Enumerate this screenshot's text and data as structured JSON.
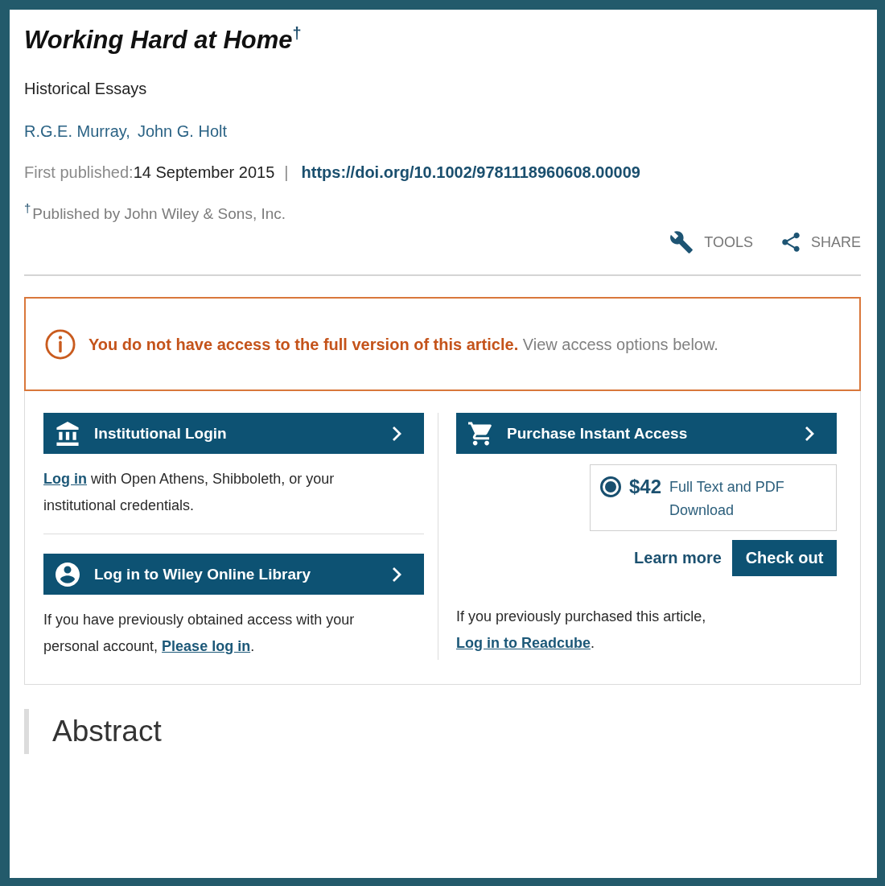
{
  "article": {
    "title": "Working Hard at Home$^{†}$",
    "subtitle": "Historical Essays",
    "authors": [
      "R.G.E. Murray,",
      "John G. Holt"
    ],
    "published_label": "First published:",
    "published_date": "14 September 2015",
    "separator": "|",
    "doi": "https://doi.org/10.1002/9781118960608.00009",
    "footnote": "$^{†}$Published by John Wiley & Sons, Inc."
  },
  "actions": [
    {
      "kind": "tools",
      "label": "TOOLS"
    },
    {
      "kind": "share",
      "label": "SHARE"
    }
  ],
  "alert": {
    "message": "**You do not have access to the full version of this article.** View access options below."
  },
  "access": {
    "logins": [
      {
        "kind": "institution",
        "label": "Institutional Login",
        "note": [
          {
            "kind": "link",
            "text": "Log in"
          },
          {
            "kind": "text",
            "text": " with Open Athens, Shibboleth, or your institutional credentials."
          }
        ]
      },
      {
        "kind": "personal",
        "label": "Log in to Wiley Online Library",
        "note": [
          {
            "kind": "text",
            "text": "If you have previously obtained access with your personal account, "
          },
          {
            "kind": "link",
            "text": "Please log in"
          },
          {
            "kind": "text",
            "text": "."
          }
        ]
      }
    ],
    "purchase": {
      "label": "Purchase Instant Access",
      "offers": [
        {
          "price": "$42",
          "description": "Full Text and PDF Download",
          "selected": true
        }
      ],
      "learn_more": "Learn more",
      "checkout": "Check out",
      "note": [
        {
          "kind": "text",
          "text": "If you previously purchased this article, "
        },
        {
          "kind": "link",
          "text": "Log in to Readcube"
        },
        {
          "kind": "text",
          "text": "."
        }
      ]
    }
  },
  "abstract": {
    "heading": "Abstract"
  }
}
